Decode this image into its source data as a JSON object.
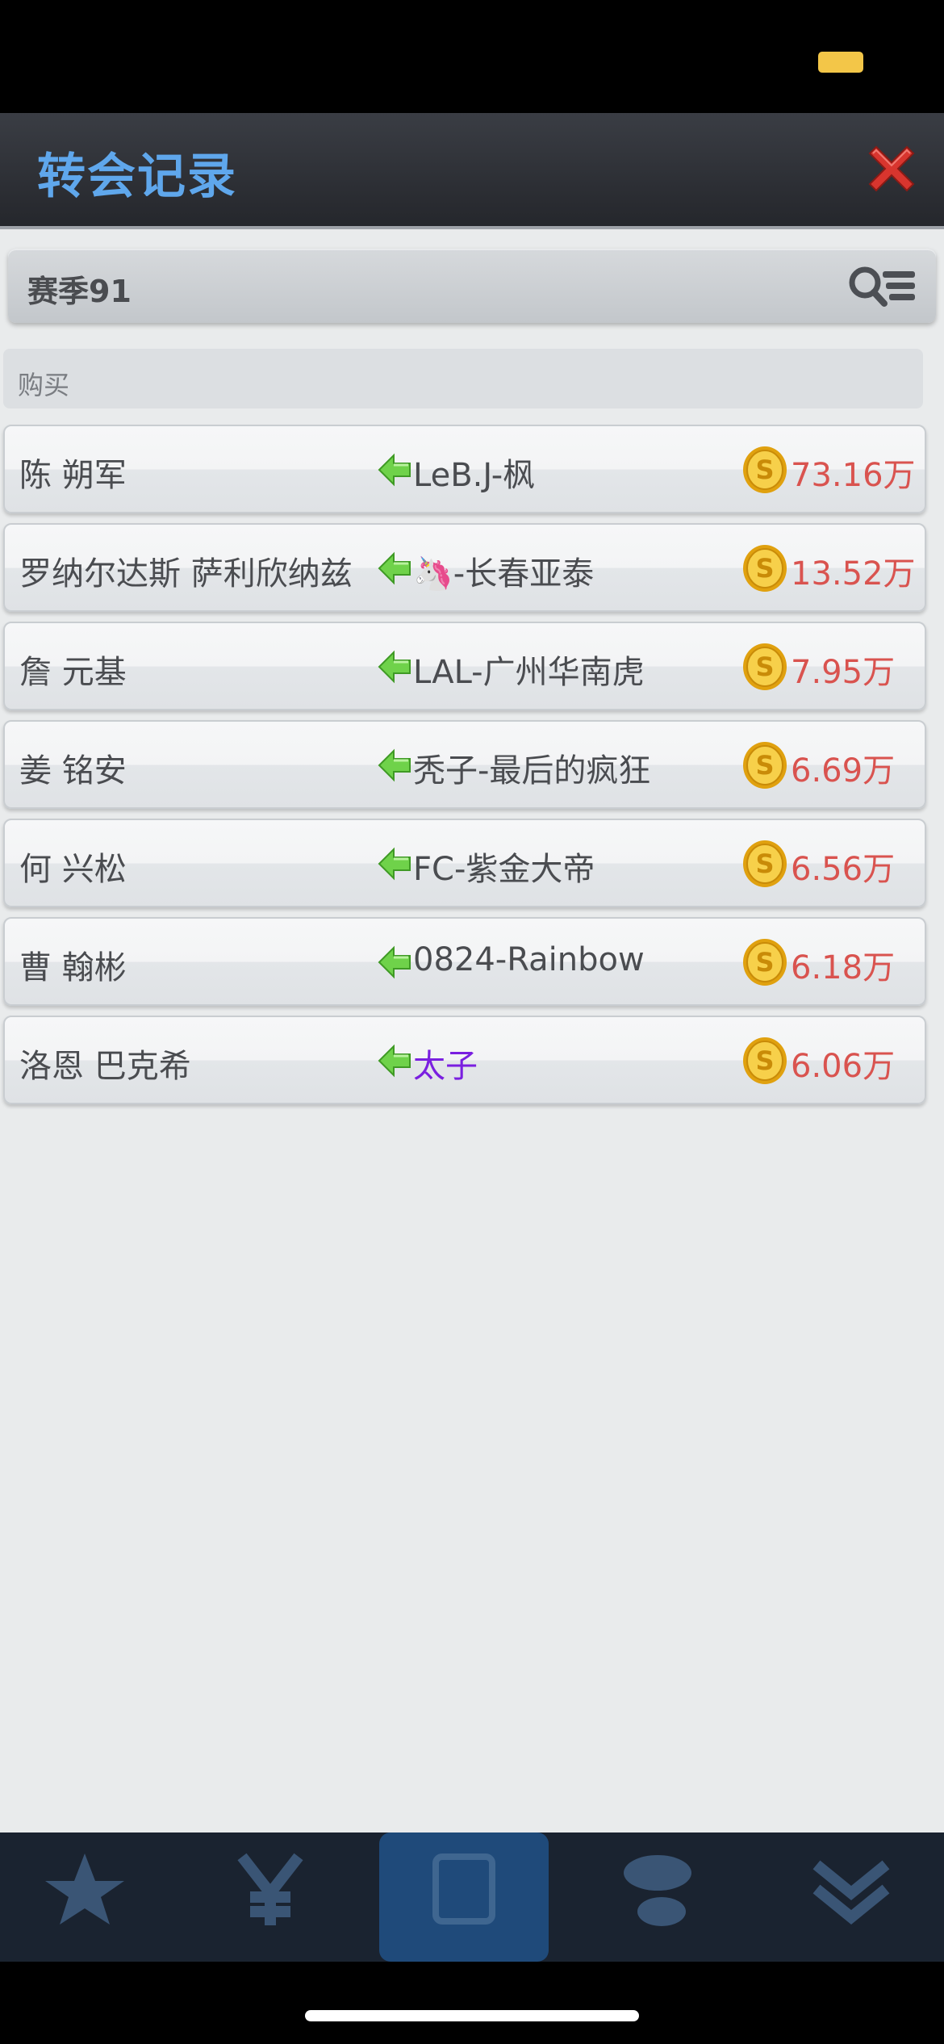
{
  "header": {
    "title": "转会记录"
  },
  "season": {
    "label": "赛季91"
  },
  "section": {
    "label": "购买"
  },
  "transfers": [
    {
      "player": "陈 朔军",
      "club": "LeB.J-枫",
      "price": "73.16万"
    },
    {
      "player": "罗纳尔达斯 萨利欣纳兹",
      "club": "🦄-长春亚泰",
      "price": "13.52万"
    },
    {
      "player": "詹 元基",
      "club": "LAL-广州华南虎",
      "price": "7.95万"
    },
    {
      "player": "姜 铭安",
      "club": "秃子-最后的疯狂",
      "price": "6.69万"
    },
    {
      "player": "何 兴松",
      "club": "FC-紫金大帝",
      "price": "6.56万"
    },
    {
      "player": "曹 翰彬",
      "club": "0824-Rainbow",
      "price": "6.18万"
    },
    {
      "player": "洛恩 巴克希",
      "club": "太子",
      "price": "6.06万"
    }
  ],
  "colors": {
    "title": "#5fa7ec",
    "price": "#d9534f",
    "highlight_club": "#7a1fe0",
    "arrow": "#6fd24a",
    "coin": "#f2c12e"
  },
  "icons": {
    "close": "close-icon",
    "filter": "search-list-icon",
    "arrow": "arrow-left-icon",
    "coin": "coin-icon"
  }
}
